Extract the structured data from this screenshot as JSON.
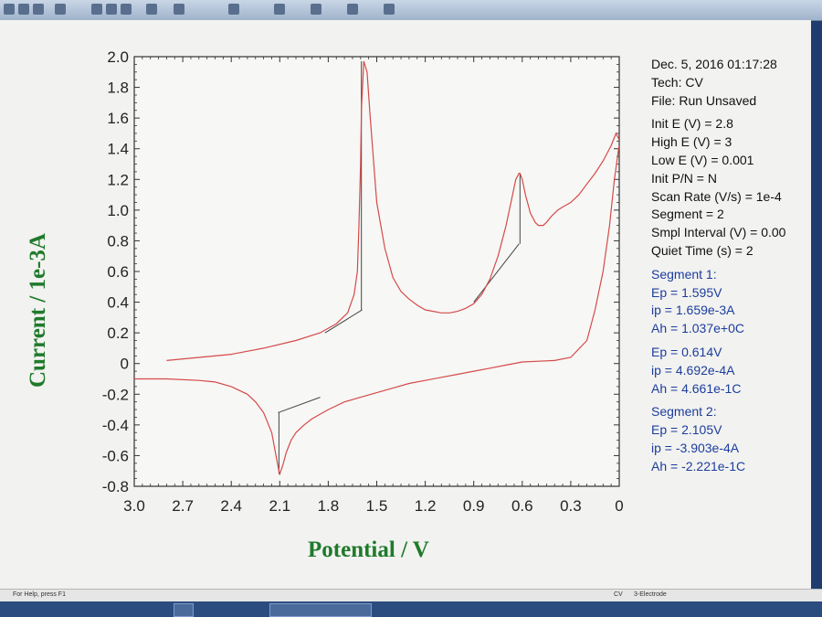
{
  "status_bar": {
    "help": "For Help, press F1",
    "cv": "CV",
    "electrode": "3-Electrode"
  },
  "colors": {
    "curve": "#d44a4a",
    "baseline": "#444444",
    "axis_label": "#1f7a2b",
    "segment_text": "#1c3d9e"
  },
  "info": {
    "header": [
      "Dec. 5, 2016   01:17:28",
      "Tech: CV",
      "File: Run Unsaved"
    ],
    "params": [
      "Init E (V) = 2.8",
      "High E (V) = 3",
      "Low E (V) = 0.001",
      "Init P/N = N",
      "Scan Rate (V/s) = 1e-4",
      "Segment = 2",
      "Smpl Interval (V) = 0.00",
      "Quiet Time (s) = 2"
    ],
    "seg1": [
      "Segment 1:",
      "Ep = 1.595V",
      "ip = 1.659e-3A",
      "Ah = 1.037e+0C"
    ],
    "seg1b": [
      "Ep = 0.614V",
      "ip = 4.692e-4A",
      "Ah = 4.661e-1C"
    ],
    "seg2": [
      "Segment 2:",
      "Ep = 2.105V",
      "ip = -3.903e-4A",
      "Ah = -2.221e-1C"
    ]
  },
  "chart_data": {
    "type": "line",
    "xlabel": "Potential / V",
    "ylabel": "Current / 1e-3A",
    "x_ticks": [
      "3.0",
      "2.7",
      "2.4",
      "2.1",
      "1.8",
      "1.5",
      "1.2",
      "0.9",
      "0.6",
      "0.3",
      "0"
    ],
    "y_ticks": [
      "2.0",
      "1.8",
      "1.6",
      "1.4",
      "1.2",
      "1.0",
      "0.8",
      "0.6",
      "0.4",
      "0.2",
      "0",
      "-0.2",
      "-0.4",
      "-0.6",
      "-0.8"
    ],
    "xlim": [
      3.0,
      0
    ],
    "ylim": [
      -0.8,
      2.0
    ],
    "series": [
      {
        "x": [
          2.8,
          2.6,
          2.4,
          2.2,
          2.0,
          1.85,
          1.75,
          1.68,
          1.64,
          1.62,
          1.61,
          1.6,
          1.595,
          1.58,
          1.56,
          1.54,
          1.5,
          1.45,
          1.4,
          1.35,
          1.3,
          1.25,
          1.2,
          1.15,
          1.1,
          1.05,
          1.0,
          0.95,
          0.9,
          0.85,
          0.8,
          0.75,
          0.7,
          0.66,
          0.64,
          0.62,
          0.614,
          0.6,
          0.58,
          0.55,
          0.52,
          0.5,
          0.47,
          0.45,
          0.42,
          0.38,
          0.35,
          0.3,
          0.25,
          0.2,
          0.15,
          0.1,
          0.05,
          0.02,
          0.001
        ],
        "y": [
          0.02,
          0.04,
          0.06,
          0.1,
          0.15,
          0.2,
          0.26,
          0.33,
          0.45,
          0.6,
          0.9,
          1.3,
          1.65,
          1.97,
          1.9,
          1.6,
          1.05,
          0.75,
          0.56,
          0.47,
          0.42,
          0.38,
          0.35,
          0.34,
          0.33,
          0.33,
          0.34,
          0.36,
          0.39,
          0.45,
          0.55,
          0.7,
          0.9,
          1.1,
          1.2,
          1.24,
          1.24,
          1.2,
          1.1,
          0.98,
          0.92,
          0.9,
          0.9,
          0.92,
          0.96,
          1.0,
          1.02,
          1.05,
          1.1,
          1.17,
          1.24,
          1.32,
          1.42,
          1.5,
          1.46
        ]
      },
      {
        "x": [
          0.001,
          0.03,
          0.06,
          0.1,
          0.15,
          0.2,
          0.3,
          0.4,
          0.5,
          0.6,
          0.7,
          0.8,
          0.9,
          1.0,
          1.1,
          1.2,
          1.3,
          1.4,
          1.5,
          1.6,
          1.7,
          1.8,
          1.85,
          1.9,
          1.95,
          2.0,
          2.03,
          2.06,
          2.08,
          2.1,
          2.105,
          2.12,
          2.15,
          2.2,
          2.25,
          2.3,
          2.4,
          2.5,
          2.6,
          2.8,
          3.0
        ],
        "y": [
          1.42,
          1.2,
          0.9,
          0.6,
          0.35,
          0.15,
          0.04,
          0.02,
          0.015,
          0.01,
          -0.01,
          -0.03,
          -0.05,
          -0.07,
          -0.09,
          -0.11,
          -0.13,
          -0.16,
          -0.19,
          -0.22,
          -0.25,
          -0.3,
          -0.33,
          -0.36,
          -0.4,
          -0.45,
          -0.5,
          -0.58,
          -0.66,
          -0.72,
          -0.7,
          -0.62,
          -0.45,
          -0.32,
          -0.25,
          -0.2,
          -0.15,
          -0.12,
          -0.11,
          -0.1,
          -0.1
        ]
      }
    ],
    "peak_baselines": [
      {
        "x": [
          1.82,
          1.59
        ],
        "y": [
          0.2,
          0.35
        ]
      },
      {
        "x": [
          0.9,
          0.62
        ],
        "y": [
          0.4,
          0.78
        ]
      },
      {
        "x": [
          2.11,
          1.85
        ],
        "y": [
          -0.32,
          -0.22
        ]
      }
    ],
    "peak_markers": [
      {
        "x": 1.595,
        "y": [
          0.35,
          1.97
        ]
      },
      {
        "x": 0.614,
        "y": [
          0.78,
          1.24
        ]
      },
      {
        "x": 2.105,
        "y": [
          -0.32,
          -0.72
        ]
      }
    ]
  }
}
